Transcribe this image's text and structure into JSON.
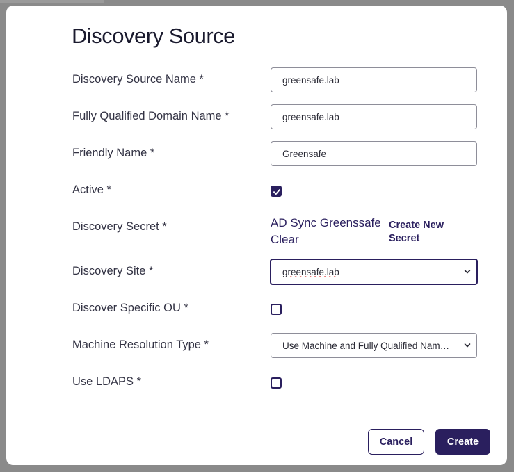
{
  "dialog": {
    "title": "Discovery Source"
  },
  "form": {
    "source_name": {
      "label": "Discovery Source Name *",
      "value": "greensafe.lab"
    },
    "fqdn": {
      "label": "Fully Qualified Domain Name *",
      "value": "greensafe.lab"
    },
    "friendly_name": {
      "label": "Friendly Name *",
      "value": "Greensafe"
    },
    "active": {
      "label": "Active *",
      "checked": true
    },
    "secret": {
      "label": "Discovery Secret *",
      "value": "AD Sync Greenssafe Clear",
      "create_link": "Create New Secret"
    },
    "site": {
      "label": "Discovery Site *",
      "value": "greensafe.lab"
    },
    "specific_ou": {
      "label": "Discover Specific OU *",
      "checked": false
    },
    "resolution": {
      "label": "Machine Resolution Type *",
      "value": "Use Machine and Fully Qualified Name (…"
    },
    "ldaps": {
      "label": "Use LDAPS *",
      "checked": false
    }
  },
  "actions": {
    "cancel_label": "Cancel",
    "create_label": "Create"
  },
  "colors": {
    "accent": "#2a1f5e",
    "text": "#333344",
    "border": "#8e8e99"
  }
}
